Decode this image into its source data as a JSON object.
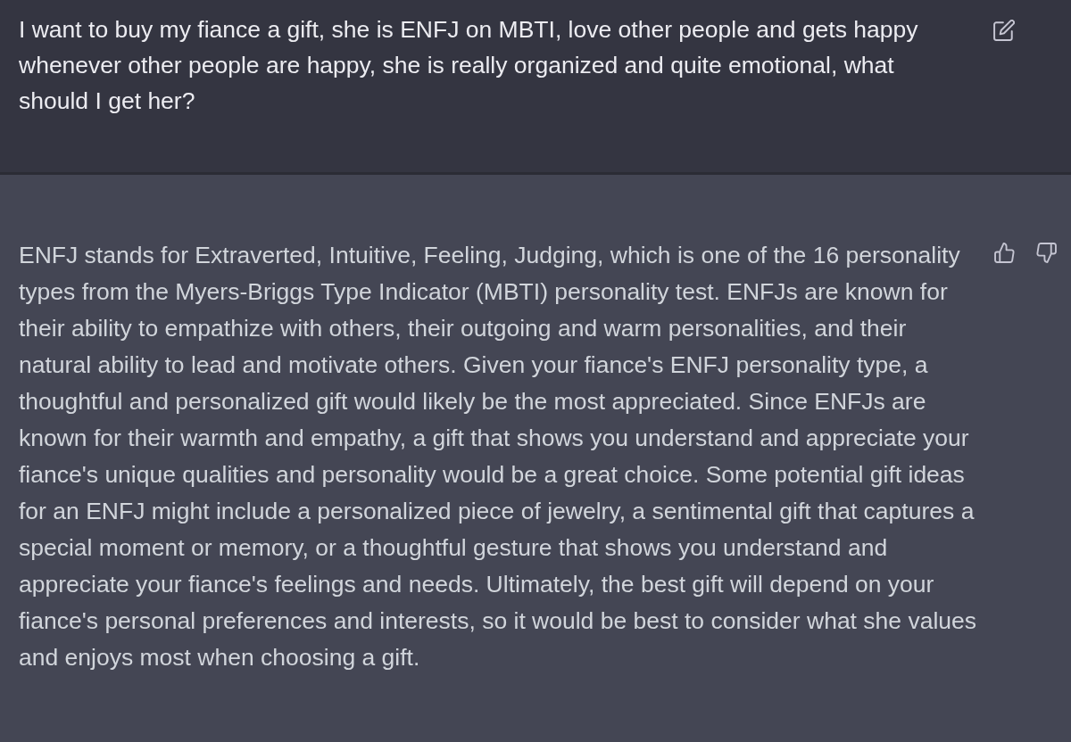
{
  "messages": [
    {
      "kind": "user",
      "text": "I want to buy my fiance a gift, she is ENFJ on MBTI, love other people and gets happy whenever other people are happy, she is really organized and quite emotional, what should I get her?"
    },
    {
      "kind": "assistant",
      "text": "ENFJ stands for Extraverted, Intuitive, Feeling, Judging, which is one of the 16 personality types from the Myers-Briggs Type Indicator (MBTI) personality test. ENFJs are known for their ability to empathize with others, their outgoing and warm personalities, and their natural ability to lead and motivate others. Given your fiance's ENFJ personality type, a thoughtful and personalized gift would likely be the most appreciated. Since ENFJs are known for their warmth and empathy, a gift that shows you understand and appreciate your fiance's unique qualities and personality would be a great choice. Some potential gift ideas for an ENFJ might include a personalized piece of jewelry, a sentimental gift that captures a special moment or memory, or a thoughtful gesture that shows you understand and appreciate your fiance's feelings and needs. Ultimately, the best gift will depend on your fiance's personal preferences and interests, so it would be best to consider what she values and enjoys most when choosing a gift."
    }
  ]
}
